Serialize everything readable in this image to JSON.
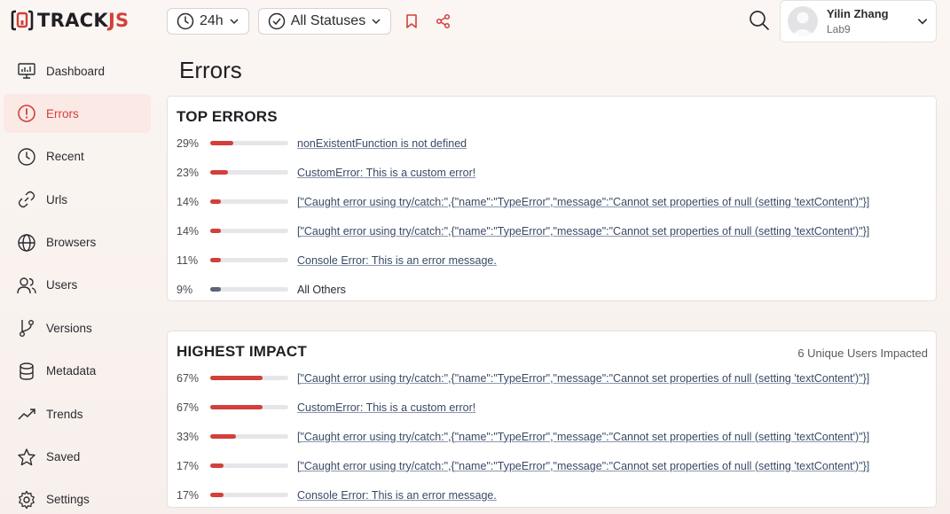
{
  "brand": {
    "name_a": "TRACK",
    "name_b": "JS",
    "accent": "#d33f3a"
  },
  "topbar": {
    "time_filter": "24h",
    "status_filter": "All Statuses"
  },
  "user": {
    "name": "Yilin Zhang",
    "org": "Lab9"
  },
  "sidebar": {
    "items": [
      {
        "label": "Dashboard",
        "icon": "dashboard-icon"
      },
      {
        "label": "Errors",
        "icon": "alert-circle-icon",
        "active": true
      },
      {
        "label": "Recent",
        "icon": "clock-icon"
      },
      {
        "label": "Urls",
        "icon": "link-icon"
      },
      {
        "label": "Browsers",
        "icon": "globe-icon"
      },
      {
        "label": "Users",
        "icon": "users-icon"
      },
      {
        "label": "Versions",
        "icon": "branch-icon"
      },
      {
        "label": "Metadata",
        "icon": "database-icon"
      },
      {
        "label": "Trends",
        "icon": "trend-icon"
      },
      {
        "label": "Saved",
        "icon": "star-icon"
      },
      {
        "label": "Settings",
        "icon": "gear-icon"
      }
    ]
  },
  "page": {
    "title": "Errors"
  },
  "top_errors": {
    "title": "TOP ERRORS",
    "rows": [
      {
        "pct": "29%",
        "value": 0.29,
        "text": "nonExistentFunction is not defined"
      },
      {
        "pct": "23%",
        "value": 0.23,
        "text": "CustomError: This is a custom error!"
      },
      {
        "pct": "14%",
        "value": 0.14,
        "text": "[\"Caught error using try/catch:\",{\"name\":\"TypeError\",\"message\":\"Cannot set properties of null (setting 'textContent')\"}]"
      },
      {
        "pct": "14%",
        "value": 0.14,
        "text": "[\"Caught error using try/catch:\",{\"name\":\"TypeError\",\"message\":\"Cannot set properties of null (setting 'textContent')\"}]"
      },
      {
        "pct": "11%",
        "value": 0.11,
        "text": "Console Error: This is an error message."
      },
      {
        "pct": "9%",
        "value": 0.09,
        "text": "All Others",
        "plain": true
      }
    ]
  },
  "highest_impact": {
    "title": "HIGHEST IMPACT",
    "subtitle": "6 Unique Users Impacted",
    "rows": [
      {
        "pct": "67%",
        "value": 0.67,
        "text": "[\"Caught error using try/catch:\",{\"name\":\"TypeError\",\"message\":\"Cannot set properties of null (setting 'textContent')\"}]"
      },
      {
        "pct": "67%",
        "value": 0.67,
        "text": "CustomError: This is a custom error!"
      },
      {
        "pct": "33%",
        "value": 0.33,
        "text": "[\"Caught error using try/catch:\",{\"name\":\"TypeError\",\"message\":\"Cannot set properties of null (setting 'textContent')\"}]"
      },
      {
        "pct": "17%",
        "value": 0.17,
        "text": "[\"Caught error using try/catch:\",{\"name\":\"TypeError\",\"message\":\"Cannot set properties of null (setting 'textContent')\"}]"
      },
      {
        "pct": "17%",
        "value": 0.17,
        "text": "Console Error: This is an error message."
      }
    ]
  },
  "colors": {
    "bar_fill": "#d33f3a",
    "bar_other": "#5c6478",
    "bar_track": "#e6e6ea"
  }
}
